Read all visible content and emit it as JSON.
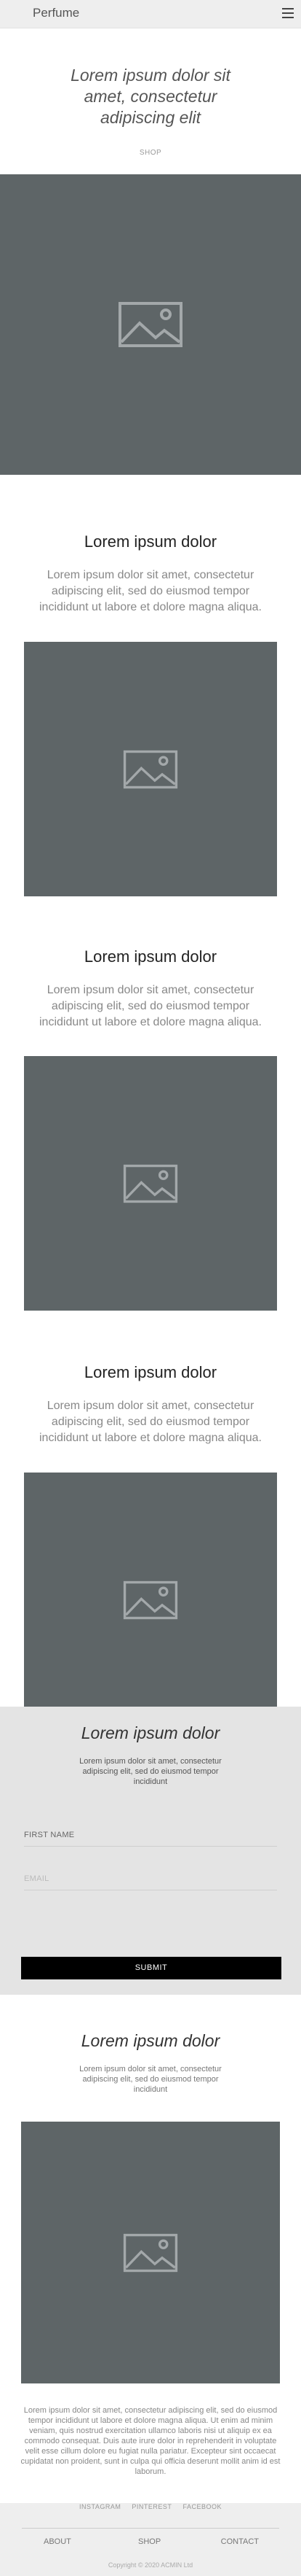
{
  "header": {
    "brand": "Perfume",
    "menu_icon": "hamburger-icon"
  },
  "hero": {
    "title": "Lorem ipsum dolor sit amet, consectetur adipiscing elit",
    "shop_link": "SHOP",
    "image_icon": "image-placeholder-icon"
  },
  "sections": [
    {
      "title": "Lorem ipsum dolor",
      "text": "Lorem ipsum dolor sit amet, consectetur adipiscing elit, sed do eiusmod tempor incididunt ut labore et dolore magna aliqua."
    },
    {
      "title": "Lorem ipsum dolor",
      "text": "Lorem ipsum dolor sit amet, consectetur adipiscing elit, sed do eiusmod tempor incididunt ut labore et dolore magna aliqua."
    },
    {
      "title": "Lorem ipsum dolor",
      "text": "Lorem ipsum dolor sit amet, consectetur adipiscing elit, sed do eiusmod tempor incididunt ut labore et dolore magna aliqua."
    }
  ],
  "form": {
    "title": "Lorem ipsum dolor",
    "text": "Lorem ipsum dolor sit amet, consectetur adipiscing elit, sed do eiusmod tempor incididunt",
    "first_name_label": "FIRST NAME",
    "email_placeholder": "EMAIL",
    "submit_label": "SUBMIT"
  },
  "closing": {
    "title": "Lorem ipsum dolor",
    "lead": "Lorem ipsum dolor sit amet, consectetur adipiscing elit, sed do eiusmod tempor incididunt",
    "body": "Lorem ipsum dolor sit amet, consectetur adipiscing elit, sed do eiusmod tempor incididunt ut labore et dolore magna aliqua. Ut enim ad minim veniam, quis nostrud exercitation ullamco laboris nisi ut aliquip ex ea commodo consequat. Duis aute irure dolor in reprehenderit in voluptate velit esse cillum dolore eu fugiat nulla pariatur. Excepteur sint occaecat cupidatat non proident, sunt in culpa qui officia deserunt mollit anim id est laborum."
  },
  "footer": {
    "social": [
      "INSTAGRAM",
      "PINTEREST",
      "FACEBOOK"
    ],
    "nav": [
      "ABOUT",
      "SHOP",
      "CONTACT"
    ],
    "copyright": "Copyright © 2020 ACMIN Ltd"
  },
  "colors": {
    "placeholder": "#5e6567",
    "form_bg": "#e4e4e4",
    "submit_bg": "#000000",
    "bar_bg": "#eeeeee"
  }
}
